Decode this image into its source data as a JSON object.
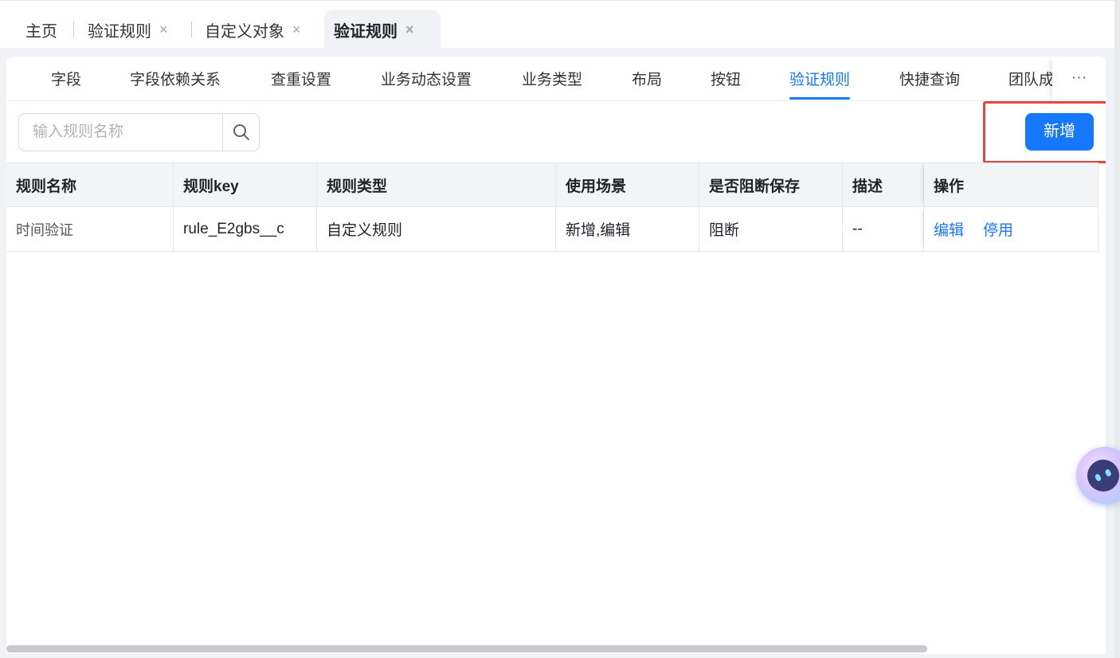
{
  "page_tabs": [
    {
      "label": "主页",
      "closable": false,
      "active": false
    },
    {
      "label": "验证规则",
      "closable": true,
      "active": false
    },
    {
      "label": "自定义对象",
      "closable": true,
      "active": false
    },
    {
      "label": "验证规则",
      "closable": true,
      "active": true
    }
  ],
  "close_glyph": "×",
  "sub_tabs": [
    "字段",
    "字段依赖关系",
    "查重设置",
    "业务动态设置",
    "业务类型",
    "布局",
    "按钮",
    "验证规则",
    "快捷查询",
    "团队成员"
  ],
  "sub_tabs_active": "验证规则",
  "more_glyph": "···",
  "search": {
    "placeholder": "输入规则名称",
    "value": ""
  },
  "add_button_label": "新增",
  "table": {
    "columns": [
      "规则名称",
      "规则key",
      "规则类型",
      "使用场景",
      "是否阻断保存",
      "描述",
      "操作"
    ],
    "rows": [
      {
        "name": "时间验证",
        "key": "rule_E2gbs__c",
        "type": "自定义规则",
        "scene": "新增,编辑",
        "block": "阻断",
        "desc": "--",
        "actions": [
          "编辑",
          "停用"
        ]
      }
    ]
  },
  "colors": {
    "accent": "#1677ff",
    "highlight": "#e5473f"
  },
  "icons": {
    "search": "search-icon",
    "more": "more-icon",
    "assistant": "assistant-robot-icon"
  }
}
